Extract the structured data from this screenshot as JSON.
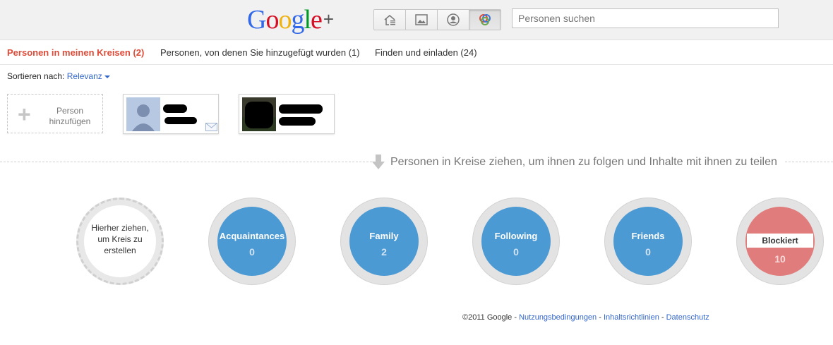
{
  "header": {
    "logo_text": "Google",
    "logo_plus": "+",
    "nav_icons": [
      "home-icon",
      "photos-icon",
      "profile-icon",
      "circles-icon"
    ],
    "search_placeholder": "Personen suchen"
  },
  "tabs": [
    {
      "label": "Personen in meinen Kreisen (2)",
      "active": true
    },
    {
      "label": "Personen, von denen Sie hinzugefügt wurden (1)",
      "active": false
    },
    {
      "label": "Finden und einladen (24)",
      "active": false
    }
  ],
  "sort": {
    "label": "Sortieren nach:",
    "value": "Relevanz"
  },
  "add_person": {
    "label_line1": "Person",
    "label_line2": "hinzufügen",
    "icon": "plus-icon"
  },
  "hint": {
    "text": "Personen in Kreise ziehen, um ihnen zu folgen und Inhalte mit ihnen zu teilen",
    "icon": "arrow-down-icon"
  },
  "new_circle": {
    "text": "Hierher ziehen, um Kreis zu erstellen"
  },
  "circles": [
    {
      "name": "Acquaintances",
      "count": "0"
    },
    {
      "name": "Family",
      "count": "2"
    },
    {
      "name": "Following",
      "count": "0"
    },
    {
      "name": "Friends",
      "count": "0"
    }
  ],
  "blocked": {
    "name": "Blockiert",
    "count": "10"
  },
  "footer": {
    "copyright": "©2011 Google",
    "sep": " - ",
    "links": [
      "Nutzungsbedingungen",
      "Inhaltsrichtlinien",
      "Datenschutz"
    ]
  },
  "colors": {
    "accent_red": "#dd4b39",
    "circle_blue": "#4c9ad4",
    "blocked_red": "#e07c7c",
    "link_blue": "#3366cc"
  }
}
